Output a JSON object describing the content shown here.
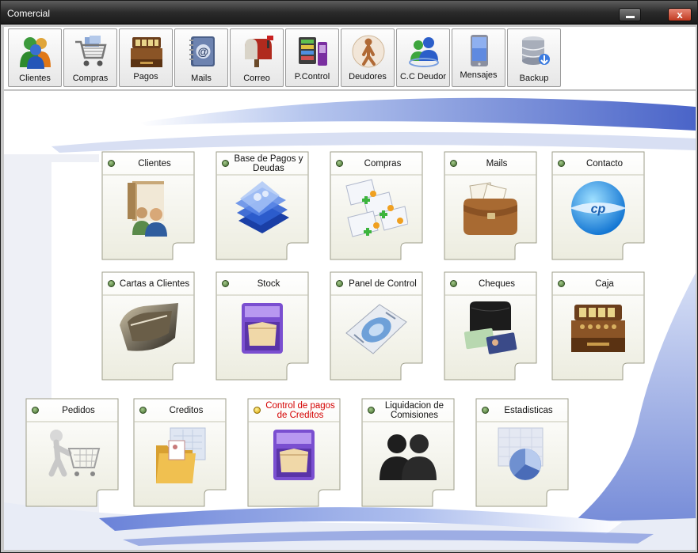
{
  "window": {
    "title": "Comercial",
    "close_glyph": "x"
  },
  "toolbar": [
    {
      "label": "Clientes",
      "icon": "users-icon"
    },
    {
      "label": "Compras",
      "icon": "cart-icon"
    },
    {
      "label": "Pagos",
      "icon": "cash-register-icon"
    },
    {
      "label": "Mails",
      "icon": "address-book-icon"
    },
    {
      "label": "Correo",
      "icon": "mailbox-icon"
    },
    {
      "label": "P.Control",
      "icon": "control-panel-icon"
    },
    {
      "label": "Deudores",
      "icon": "person-figure-icon"
    },
    {
      "label": "C.C Deudor",
      "icon": "messenger-icon"
    },
    {
      "label": "Mensajes",
      "icon": "mobile-phone-icon"
    },
    {
      "label": "Backup",
      "icon": "database-icon"
    }
  ],
  "tiles": [
    {
      "label": "Clientes",
      "icon": "contacts-folder-icon",
      "status": "green"
    },
    {
      "label": "Base de Pagos y Deudas",
      "icon": "stacked-glass-icon",
      "status": "green"
    },
    {
      "label": "Compras",
      "icon": "documents-icon",
      "status": "green"
    },
    {
      "label": "Mails",
      "icon": "mail-bag-icon",
      "status": "green"
    },
    {
      "label": "Contacto",
      "icon": "globe-logo-icon",
      "status": "green"
    },
    {
      "label": "Cartas a Clientes",
      "icon": "letter-tray-icon",
      "status": "green"
    },
    {
      "label": "Stock",
      "icon": "file-drawer-icon",
      "status": "green"
    },
    {
      "label": "Panel de Control",
      "icon": "control-panel-icon",
      "status": "green"
    },
    {
      "label": "Cheques",
      "icon": "wallet-icon",
      "status": "green"
    },
    {
      "label": "Caja",
      "icon": "cash-register-icon",
      "status": "green"
    },
    {
      "label": "Pedidos",
      "icon": "shopping-cart-figure-icon",
      "status": "green"
    },
    {
      "label": "Creditos",
      "icon": "folder-icon",
      "status": "green"
    },
    {
      "label": "Control de pagos de Creditos",
      "icon": "file-drawer-icon",
      "status": "yellow",
      "label_color": "#d40000"
    },
    {
      "label": "Liquidacion de Comisiones",
      "icon": "people-silhouette-icon",
      "status": "green"
    },
    {
      "label": "Estadisticas",
      "icon": "pie-chart-icon",
      "status": "green"
    }
  ]
}
